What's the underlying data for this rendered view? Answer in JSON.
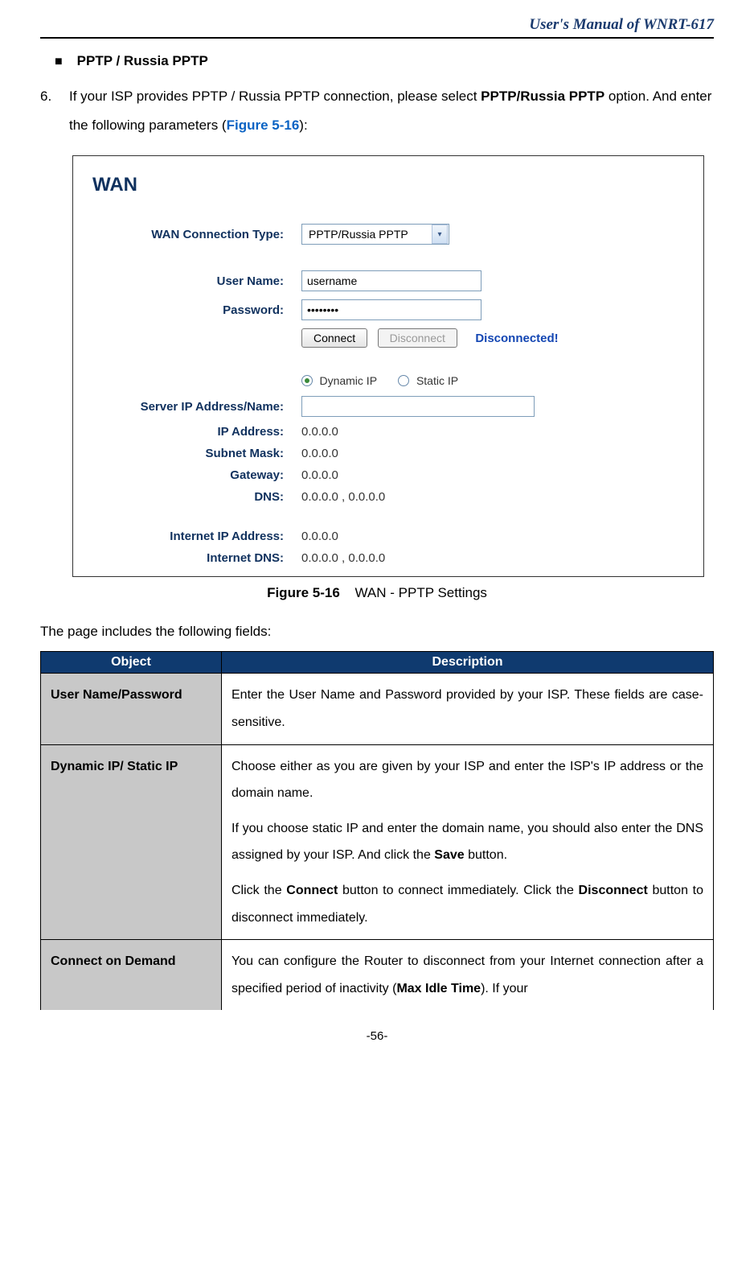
{
  "header": {
    "manual_title": "User's Manual of WNRT-617"
  },
  "section": {
    "bullet_label": "PPTP / Russia PPTP",
    "item_number": "6.",
    "para_part1": "If your ISP provides PPTP / Russia PPTP connection, please select ",
    "para_bold": "PPTP/Russia PPTP",
    "para_part2": " option. And enter the following parameters (",
    "figure_ref": "Figure 5-16",
    "para_part3": "):"
  },
  "figure": {
    "title": "WAN",
    "labels": {
      "conn_type": "WAN Connection Type:",
      "user_name": "User Name:",
      "password": "Password:",
      "server": "Server IP Address/Name:",
      "ip_address": "IP Address:",
      "subnet": "Subnet Mask:",
      "gateway": "Gateway:",
      "dns": "DNS:",
      "inet_ip": "Internet IP Address:",
      "inet_dns": "Internet DNS:"
    },
    "values": {
      "conn_type": "PPTP/Russia PPTP",
      "user_name": "username",
      "password": "••••••••",
      "ip_address": "0.0.0.0",
      "subnet": "0.0.0.0",
      "gateway": "0.0.0.0",
      "dns": "0.0.0.0 , 0.0.0.0",
      "inet_ip": "0.0.0.0",
      "inet_dns": "0.0.0.0 , 0.0.0.0"
    },
    "buttons": {
      "connect": "Connect",
      "disconnect": "Disconnect"
    },
    "status": "Disconnected!",
    "radios": {
      "dynamic": "Dynamic IP",
      "static": "Static IP"
    },
    "caption_num": "Figure 5-16",
    "caption_text": "WAN - PPTP Settings"
  },
  "fields_intro": "The page includes the following fields:",
  "table": {
    "head_obj": "Object",
    "head_desc": "Description",
    "rows": [
      {
        "object": "User Name/Password",
        "desc": "Enter the User Name and Password provided by your ISP. These fields are case-sensitive."
      },
      {
        "object": "Dynamic IP/ Static IP",
        "p1_a": "Choose either as you are given by your ISP and enter the ISP's IP address or the domain name.",
        "p2_a": "If you choose static IP and enter the domain name, you should also enter the DNS assigned by your ISP. And click the ",
        "p2_b": "Save",
        "p2_c": " button.",
        "p3_a": "Click the ",
        "p3_b": "Connect",
        "p3_c": " button to connect immediately. Click the ",
        "p3_d": "Disconnect",
        "p3_e": " button to disconnect immediately."
      },
      {
        "object": "Connect on Demand",
        "d_a": "You can configure the Router to disconnect from your Internet connection after a specified period of inactivity (",
        "d_b": "Max Idle Time",
        "d_c": "). If your"
      }
    ]
  },
  "page_number": "-56-"
}
